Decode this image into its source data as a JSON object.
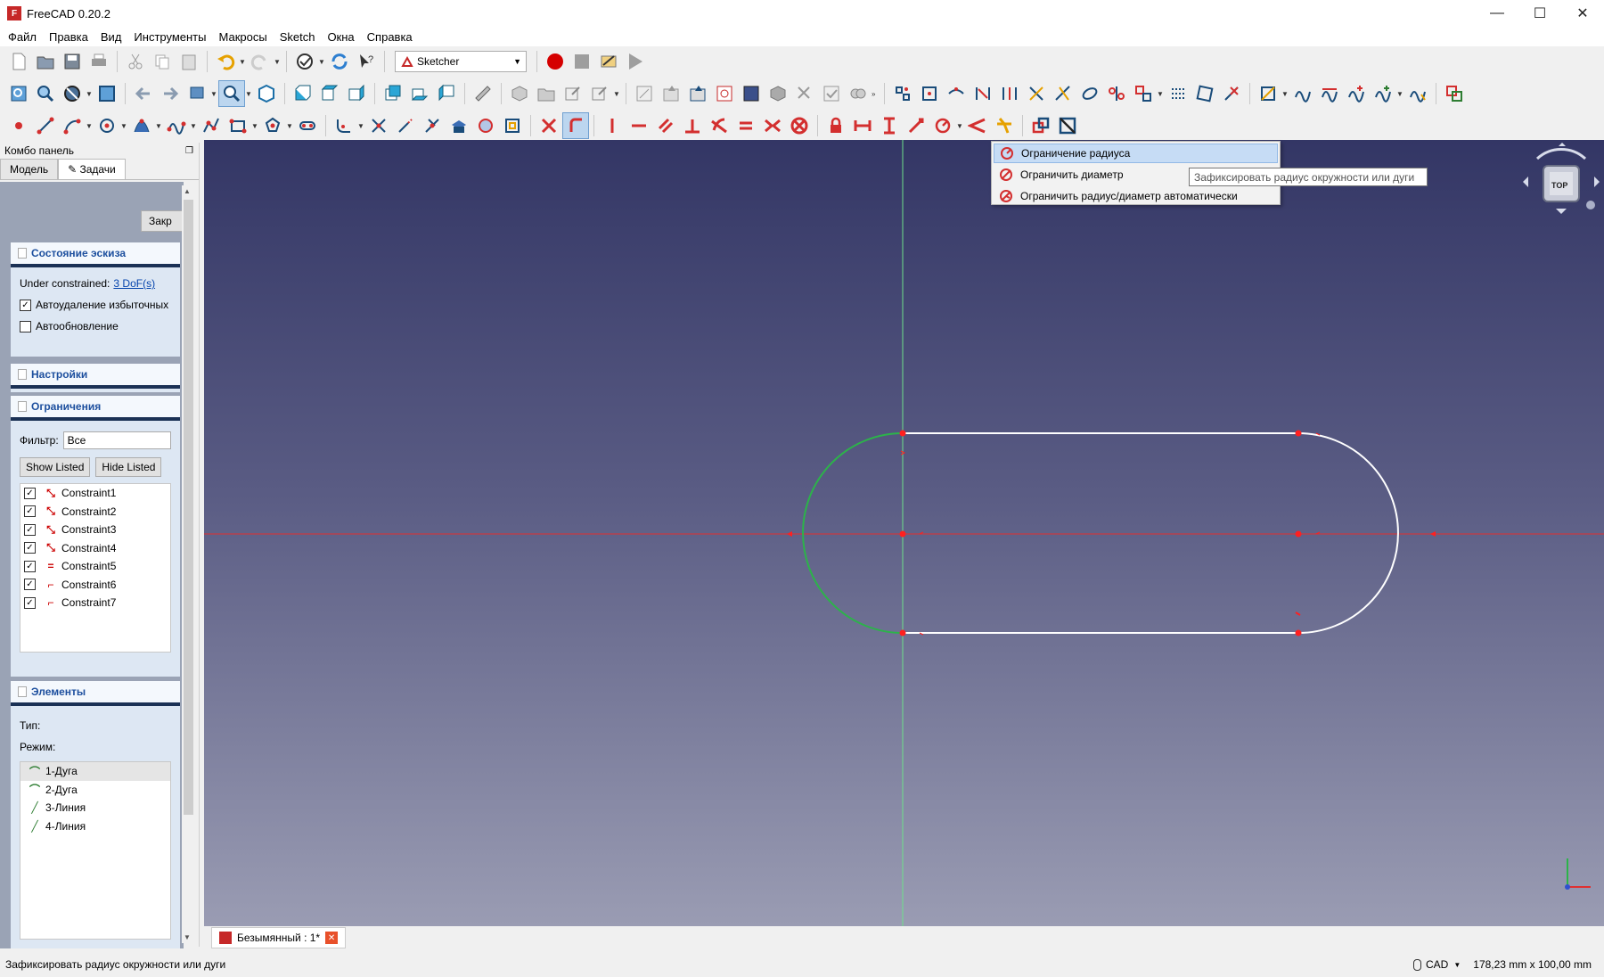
{
  "window": {
    "title": "FreeCAD 0.20.2",
    "minimize": "—",
    "maximize": "☐",
    "close": "✕"
  },
  "menu": [
    "Файл",
    "Правка",
    "Вид",
    "Инструменты",
    "Макросы",
    "Sketch",
    "Окна",
    "Справка"
  ],
  "toolbar": {
    "workbench": "Sketcher"
  },
  "combo": {
    "title": "Комбо панель",
    "tabs": [
      "Модель",
      "Задачи"
    ],
    "close_button": "Закр"
  },
  "sketch_state": {
    "header": "Состояние эскиза",
    "status_label": "Under constrained:",
    "status_link": "3 DoF(s)",
    "auto_remove": "Автоудаление избыточных",
    "auto_update": "Автообновление"
  },
  "settings": {
    "header": "Настройки"
  },
  "constraints": {
    "header": "Ограничения",
    "filter_label": "Фильтр:",
    "filter_value": "Все",
    "show_listed": "Show Listed",
    "hide_listed": "Hide Listed",
    "items": [
      {
        "name": "Constraint1",
        "icon": "tangent-icon"
      },
      {
        "name": "Constraint2",
        "icon": "tangent-icon"
      },
      {
        "name": "Constraint3",
        "icon": "tangent-icon"
      },
      {
        "name": "Constraint4",
        "icon": "tangent-icon"
      },
      {
        "name": "Constraint5",
        "icon": "equal-icon"
      },
      {
        "name": "Constraint6",
        "icon": "radius-icon"
      },
      {
        "name": "Constraint7",
        "icon": "radius-icon"
      }
    ]
  },
  "elements": {
    "header": "Элементы",
    "type_label": "Тип:",
    "mode_label": "Режим:",
    "items": [
      "1-Дуга",
      "2-Дуга",
      "3-Линия",
      "4-Линия"
    ]
  },
  "dropdown": {
    "items": [
      "Ограничение радиуса",
      "Ограничить диаметр",
      "Ограничить радиус/диаметр автоматически"
    ]
  },
  "tooltip": "Зафиксировать радиус окружности или дуги",
  "navcube": {
    "face": "TOP"
  },
  "document_tab": {
    "label": "Безымянный : 1*"
  },
  "statusbar": {
    "message": "Зафиксировать радиус окружности или дуги",
    "nav_style": "CAD",
    "dimensions": "178,23 mm x 100,00 mm"
  },
  "colors": {
    "accent_red": "#d32f2f",
    "viewport_top": "#333665",
    "viewport_bottom": "#9a9cb3",
    "link_blue": "#0645ad",
    "panel_header_text": "#1d4f9e"
  }
}
